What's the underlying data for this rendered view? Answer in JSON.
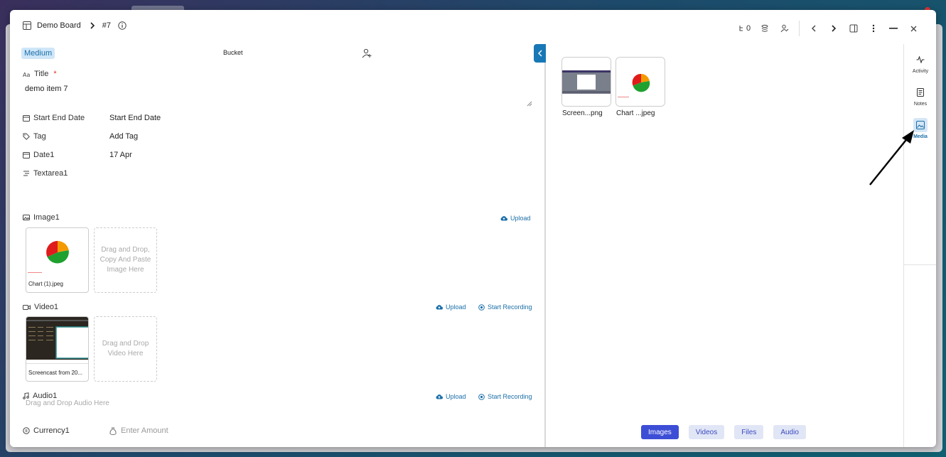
{
  "header": {
    "board": "Demo Board",
    "item_no": "#7",
    "subtasks_count": "0"
  },
  "left": {
    "priority": "Medium",
    "bucket": "Bucket",
    "fields": {
      "title_label": "Title",
      "title_value": "demo item 7",
      "start_end_label": "Start End Date",
      "start_end_value": "Start End Date",
      "tag_label": "Tag",
      "tag_value": "Add Tag",
      "date1_label": "Date1",
      "date1_value": "17 Apr",
      "textarea1_label": "Textarea1"
    },
    "image1": {
      "label": "Image1",
      "upload": "Upload",
      "thumb_caption": "Chart (1).jpeg",
      "drop_text": "Drag and Drop, Copy And Paste Image Here"
    },
    "video1": {
      "label": "Video1",
      "upload": "Upload",
      "record": "Start Recording",
      "thumb_caption": "Screencast from 20...",
      "drop_text": "Drag and Drop Video Here"
    },
    "audio1": {
      "label": "Audio1",
      "upload": "Upload",
      "record": "Start Recording",
      "drop_text": "Drag and Drop Audio Here"
    },
    "currency1": {
      "label": "Currency1",
      "placeholder": "Enter Amount"
    }
  },
  "media": {
    "items": [
      {
        "caption": "Screen...png"
      },
      {
        "caption": "Chart ...jpeg"
      }
    ],
    "tabs": [
      "Images",
      "Videos",
      "Files",
      "Audio"
    ],
    "active_tab": "Images"
  },
  "rail": {
    "activity": "Activity",
    "notes": "Notes",
    "media": "Media"
  },
  "colors": {
    "accent": "#1a6fa8",
    "tab_active": "#3d4ed6",
    "pie_red": "#e01b1b",
    "pie_orange": "#f39a00",
    "pie_green": "#1fa12f"
  }
}
